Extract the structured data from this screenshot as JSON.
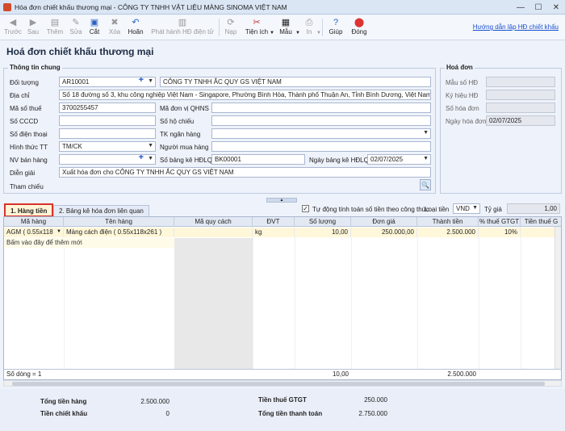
{
  "window": {
    "title": "Hóa đơn chiết khấu thương mại - CÔNG TY TNHH VẬT LIỆU MÀNG SINOMA VIỆT NAM",
    "min": "—",
    "max": "☐",
    "close": "✕"
  },
  "toolbar": {
    "back": "Trước",
    "next": "Sau",
    "add": "Thêm",
    "edit": "Sửa",
    "cut": "Cắt",
    "delete": "Xóa",
    "undo": "Hoãn",
    "issue": "Phát hành HĐ điện tử",
    "load": "Nạp",
    "utilities": "Tiện ích",
    "template": "Mẫu",
    "print": "In",
    "help": "Giúp",
    "close": "Đóng",
    "help_link": "Hướng dẫn lập HĐ chiết khấu"
  },
  "form_title": "Hoá đơn chiết khấu thương mại",
  "general": {
    "title": "Thông tin chung",
    "doi_tuong_label": "Đối tượng",
    "doi_tuong": "AR10001",
    "company_name": "CÔNG TY TNHH ẮC QUY GS VIỆT NAM",
    "dia_chi_label": "Địa chỉ",
    "dia_chi": "Số 18 đường số 3, khu công nghiệp Việt Nam - Singapore, Phường Bình Hòa, Thành phố Thuận An, Tỉnh Bình Dương, Việt Nam",
    "mst_label": "Mã số thuế",
    "mst": "3700255457",
    "ma_dv_label": "Mã đơn vị QHNS",
    "ma_dv": "",
    "cccd_label": "Số CCCD",
    "cccd": "",
    "ho_chieu_label": "Số hộ chiếu",
    "ho_chieu": "",
    "dien_thoai_label": "Số điện thoại",
    "dien_thoai": "",
    "tk_nh_label": "TK ngân hàng",
    "tk_nh": "",
    "httt_label": "Hình thức TT",
    "httt": "TM/CK",
    "nguoi_mua_label": "Người mua hàng",
    "nguoi_mua": "",
    "nvbh_label": "NV bán hàng",
    "nvbh": "",
    "so_bk_label": "Số bảng kê HĐLQ",
    "so_bk": "BK00001",
    "ngay_bk_label": "Ngày bảng kê HĐLQ",
    "ngay_bk": "02/07/2025",
    "dien_giai_label": "Diễn giải",
    "dien_giai": "Xuất hóa đơn cho CÔNG TY TNHH ẮC QUY GS VIỆT NAM",
    "tham_chieu_label": "Tham chiếu"
  },
  "invoice": {
    "title": "Hoá đơn",
    "mau_so_label": "Mẫu số HĐ",
    "mau_so": "",
    "ky_hieu_label": "Ký hiệu HĐ",
    "ky_hieu": "",
    "so_hd_label": "Số hóa đơn",
    "so_hd": "",
    "ngay_hd_label": "Ngày hóa đơn",
    "ngay_hd": "02/07/2025"
  },
  "tabs": {
    "hang_tien": "1. Hàng tiền",
    "bang_ke": "2. Bảng kê hóa đơn liên quan"
  },
  "options": {
    "auto_calc": "Tự động tính toán số tiền theo công thức",
    "auto_calc_checked": "✓",
    "loai_tien_label": "Loại tiền",
    "loai_tien": "VND",
    "ty_gia_label": "Tỷ giá",
    "ty_gia": "1,00"
  },
  "grid": {
    "headers": [
      "Mã hàng",
      "Tên hàng",
      "Mã quy cách",
      "ĐVT",
      "Số lượng",
      "Đơn giá",
      "Thành tiền",
      "% thuế GTGT",
      "Tiền thuế G"
    ],
    "row1": {
      "ma_hang": "AGM ( 0.55x118",
      "ten_hang": "Màng cách điện ( 0.55x118x261 )",
      "ma_qc": "",
      "dvt": "kg",
      "so_luong": "10,00",
      "don_gia": "250.000,00",
      "thanh_tien": "2.500.000",
      "thue": "10%",
      "tien_thue": ""
    },
    "add_hint": "Bấm vào đây để thêm mới",
    "footer": {
      "so_dong": "Số dòng = 1",
      "so_luong": "10,00",
      "thanh_tien": "2.500.000"
    }
  },
  "totals": {
    "tong_tien_hang_label": "Tổng tiền hàng",
    "tong_tien_hang": "2.500.000",
    "tien_ck_label": "Tiền chiết khấu",
    "tien_ck": "0",
    "tien_thue_label": "Tiền thuế GTGT",
    "tien_thue": "250.000",
    "tong_tt_label": "Tổng tiền thanh toán",
    "tong_tt": "2.750.000"
  }
}
